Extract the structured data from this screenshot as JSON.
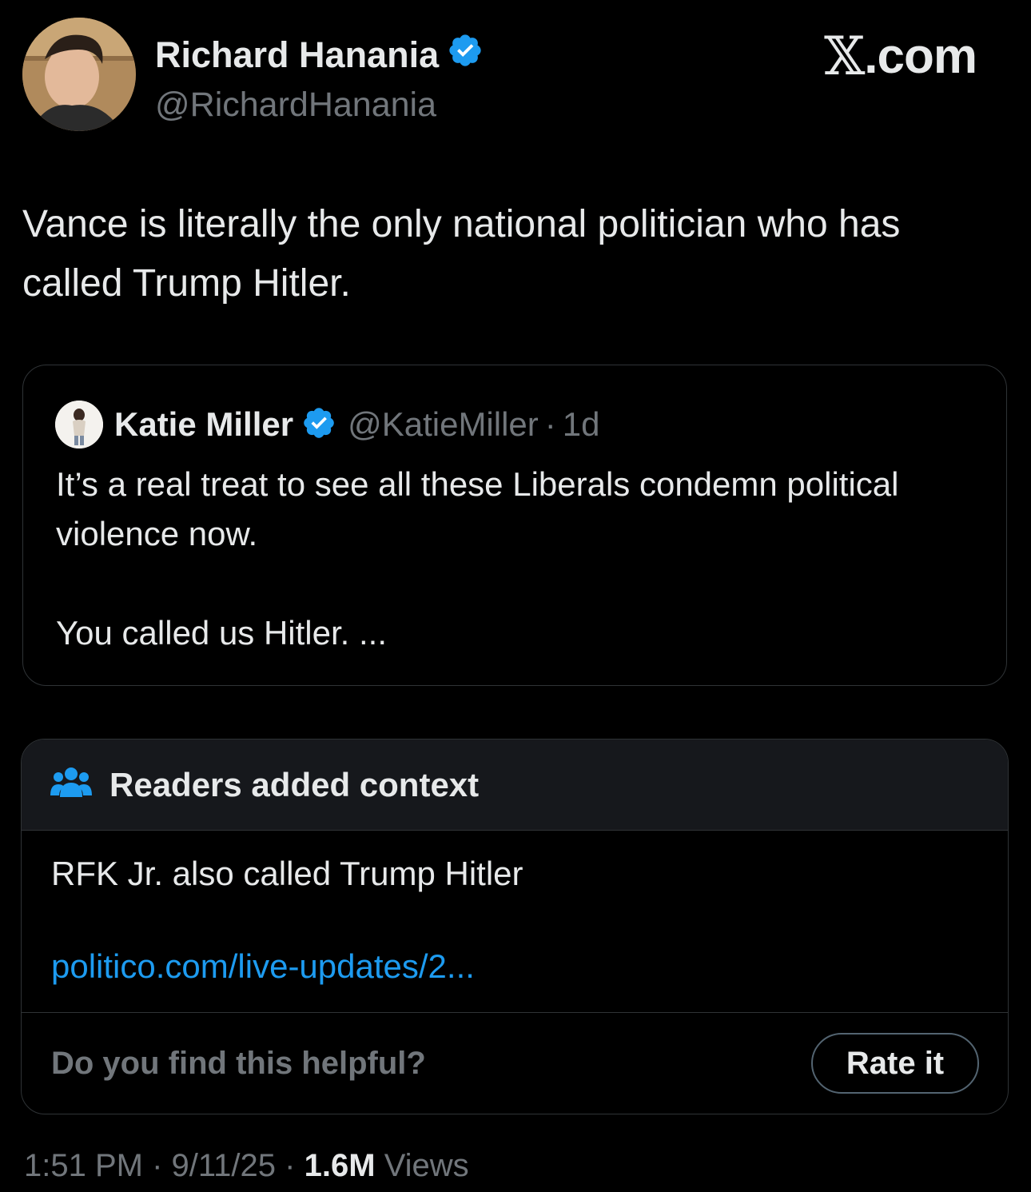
{
  "author": {
    "display_name": "Richard Hanania",
    "handle": "@RichardHanania",
    "verified": true,
    "avatar_icon": "profile-photo"
  },
  "brand": {
    "x_mark": "𝕏",
    "domain": ".com"
  },
  "tweet": {
    "text": "Vance is literally the only national politician who has called Trump Hitler."
  },
  "quoted_tweet": {
    "display_name": "Katie Miller",
    "handle": "@KatieMiller",
    "separator": "·",
    "time_ago": "1d",
    "verified": true,
    "paragraphs": [
      "It’s a real treat to see all these Liberals condemn political violence now.",
      "You called us Hitler. ..."
    ]
  },
  "community_note": {
    "header": "Readers added context",
    "header_icon": "people-group-icon",
    "text": "RFK Jr. also called Trump Hitler",
    "link": "politico.com/live-updates/2...",
    "prompt": "Do you find this helpful?",
    "rate_button": "Rate it"
  },
  "meta": {
    "time": "1:51 PM",
    "separator": "·",
    "date": "9/11/25",
    "views_count": "1.6M",
    "views_label": "Views"
  },
  "colors": {
    "background": "#000000",
    "text_primary": "#e7e9ea",
    "text_secondary": "#71767b",
    "border": "#2f3336",
    "note_header_bg": "#16181c",
    "link": "#1d9bf0",
    "verified_badge": "#1d9bf0"
  }
}
